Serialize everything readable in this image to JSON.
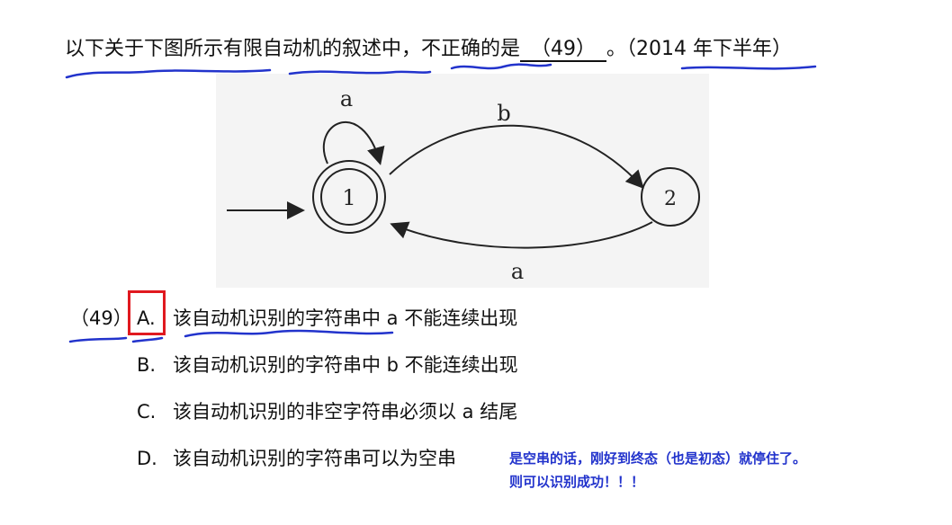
{
  "question": {
    "text_before": "以下关于下图所示有限自动机的叙述中，不正确的是",
    "blank": "（49）",
    "text_after": "。（2014 年下半年）"
  },
  "figure": {
    "states": [
      "1",
      "2"
    ],
    "transitions": [
      {
        "from": "1",
        "to": "1",
        "label": "a"
      },
      {
        "from": "1",
        "to": "2",
        "label": "b"
      },
      {
        "from": "2",
        "to": "1",
        "label": "a"
      }
    ],
    "start_state": "1",
    "accept_state": "1"
  },
  "options": {
    "number": "（49）",
    "items": [
      {
        "letter": "A.",
        "text": "该自动机识别的字符串中 a 不能连续出现"
      },
      {
        "letter": "B.",
        "text": "该自动机识别的字符串中 b 不能连续出现"
      },
      {
        "letter": "C.",
        "text": "该自动机识别的非空字符串必须以 a 结尾"
      },
      {
        "letter": "D.",
        "text": "该自动机识别的字符串可以为空串"
      }
    ]
  },
  "annotation": {
    "line1": "是空串的话，刚好到终态（也是初态）就停住了。",
    "line2": "则可以识别成功！！！"
  },
  "colors": {
    "ink_blue": "#2233cc",
    "highlight_red": "#e0191f"
  }
}
